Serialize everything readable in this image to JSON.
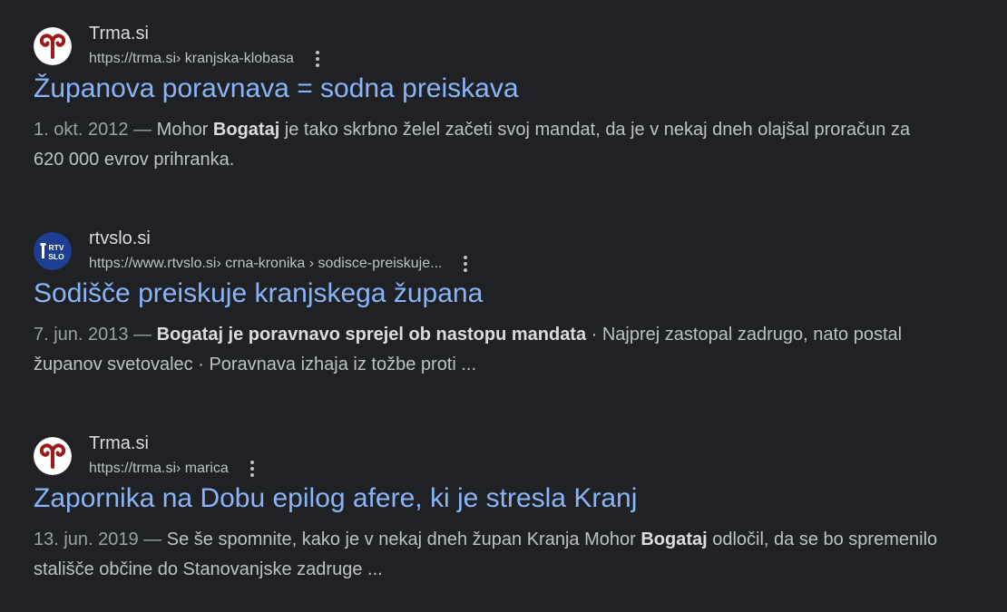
{
  "results": [
    {
      "site_name": "Trma.si",
      "url_base": "https://trma.si",
      "url_path": " › kranjska-klobasa",
      "title": "Županova poravnava = sodna preiskava",
      "date": "1. okt. 2012",
      "dash": " — ",
      "snippet_pre": "Mohor ",
      "snippet_bold": "Bogataj",
      "snippet_post": " je tako skrbno želel začeti svoj mandat, da je v nekaj dneh olajšal proračun za 620 000 evrov prihranka."
    },
    {
      "site_name": "rtvslo.si",
      "url_base": "https://www.rtvslo.si",
      "url_path": " › crna-kronika › sodisce-preiskuje...",
      "title": "Sodišče preiskuje kranjskega župana",
      "date": "7. jun. 2013",
      "dash": " — ",
      "snippet_pre": "",
      "snippet_bold": "Bogataj je poravnavo sprejel ob nastopu mandata",
      "snippet_post": " · Najprej zastopal zadrugo, nato postal županov svetovalec · Poravnava izhaja iz tožbe proti ..."
    },
    {
      "site_name": "Trma.si",
      "url_base": "https://trma.si",
      "url_path": " › marica",
      "title": "Zapornika na Dobu epilog afere, ki je stresla Kranj",
      "date": "13. jun. 2019",
      "dash": " — ",
      "snippet_pre": "Se še spomnite, kako je v nekaj dneh župan Kranja Mohor ",
      "snippet_bold": "Bogataj",
      "snippet_post": " odločil, da se bo spremenilo stališče občine do Stanovanjske zadruge ..."
    }
  ],
  "icons": {
    "trma": "ram-horns-icon",
    "rtvslo": "rtv-slo-logo-icon",
    "rtvslo_text_top": "RTV",
    "rtvslo_text_bottom": "SLO",
    "more": "more-vert-icon"
  },
  "colors": {
    "background": "#202124",
    "title_link": "#8ab4f8",
    "site_name": "#dadce0",
    "url": "#bdc1c6",
    "snippet": "#bdc1c6",
    "trma_red": "#9b1b1b",
    "rtv_blue": "#1c3f94"
  }
}
